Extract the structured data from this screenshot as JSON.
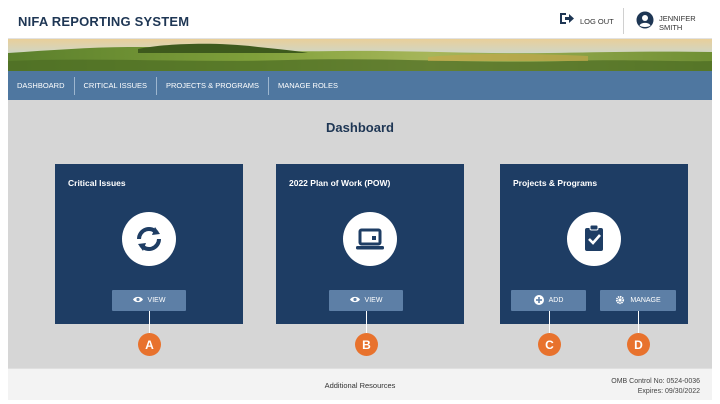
{
  "header": {
    "app_title": "NIFA REPORTING SYSTEM",
    "logout_label": "LOG OUT",
    "user_name": "JENNIFER SMITH"
  },
  "nav": {
    "items": [
      {
        "label": "DASHBOARD"
      },
      {
        "label": "CRITICAL ISSUES"
      },
      {
        "label": "PROJECTS & PROGRAMS"
      },
      {
        "label": "MANAGE ROLES"
      }
    ]
  },
  "main": {
    "title": "Dashboard",
    "cards": [
      {
        "title": "Critical Issues",
        "icon": "refresh-icon",
        "buttons": [
          {
            "label": "VIEW",
            "icon": "eye-icon",
            "callout": "A"
          }
        ]
      },
      {
        "title": "2022 Plan of Work (POW)",
        "icon": "laptop-icon",
        "buttons": [
          {
            "label": "VIEW",
            "icon": "eye-icon",
            "callout": "B"
          }
        ]
      },
      {
        "title": "Projects & Programs",
        "icon": "clipboard-check-icon",
        "buttons": [
          {
            "label": "ADD",
            "icon": "plus-circle-icon",
            "callout": "C"
          },
          {
            "label": "MANAGE",
            "icon": "gear-icon",
            "callout": "D"
          }
        ]
      }
    ]
  },
  "footer": {
    "resources_link": "Additional Resources",
    "omb_control": "OMB Control No: 0524-0036",
    "expires": "Expires: 09/30/2022"
  },
  "colors": {
    "header_text": "#1e3654",
    "nav_bg": "#4f77a0",
    "card_bg": "#1e3d64",
    "button_bg": "#5d7fa6",
    "callout": "#e8722d",
    "page_bg": "#d6d6d6"
  }
}
